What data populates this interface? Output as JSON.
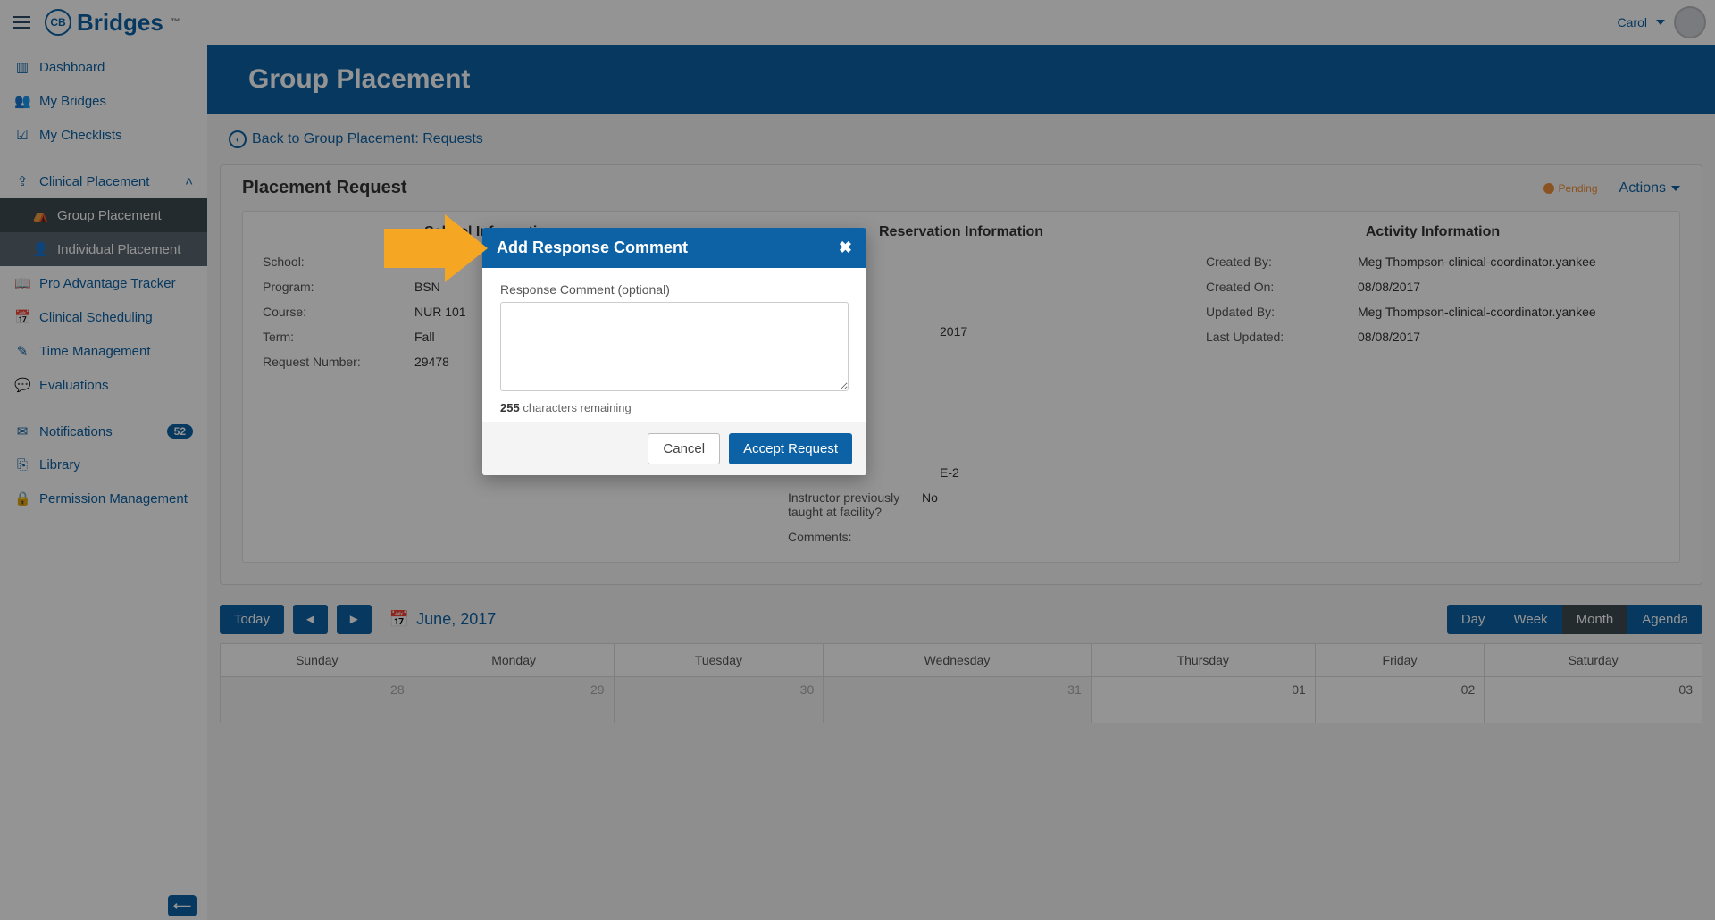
{
  "brand": {
    "badge": "CB",
    "name": "Bridges",
    "tm": "™"
  },
  "user": {
    "name": "Carol"
  },
  "sidebar": {
    "items": [
      {
        "icon": "chart",
        "label": "Dashboard"
      },
      {
        "icon": "group",
        "label": "My Bridges"
      },
      {
        "icon": "check",
        "label": "My Checklists"
      },
      {
        "icon": "upload",
        "label": "Clinical Placement",
        "expanded": true,
        "children": [
          {
            "icon": "bed",
            "label": "Group Placement",
            "active": true
          },
          {
            "icon": "person",
            "label": "Individual Placement"
          }
        ]
      },
      {
        "icon": "book",
        "label": "Pro Advantage Tracker"
      },
      {
        "icon": "calendar",
        "label": "Clinical Scheduling"
      },
      {
        "icon": "edit",
        "label": "Time Management"
      },
      {
        "icon": "chat",
        "label": "Evaluations"
      },
      {
        "gap": true
      },
      {
        "icon": "inbox",
        "label": "Notifications",
        "badge": "52"
      },
      {
        "icon": "copy",
        "label": "Library"
      },
      {
        "icon": "lock",
        "label": "Permission Management"
      }
    ]
  },
  "page": {
    "title": "Group Placement",
    "back": "Back to Group Placement: Requests"
  },
  "panel": {
    "title": "Placement Request",
    "status": "Pending",
    "actions": "Actions",
    "school_head": "School Information",
    "reservation_head": "Reservation Information",
    "activity_head": "Activity Information",
    "school": {
      "School:": "",
      "Program:": "BSN",
      "Course:": "NUR 101",
      "Term:": "Fall",
      "Request Number:": "29478"
    },
    "reservation": {
      "r1_val": "2017",
      "r2_val": "E-2",
      "r3_label": "Instructor previously taught at facility?",
      "r3_val": "No",
      "r4_label": "Comments:"
    },
    "activity": {
      "Created By:": "Meg Thompson-clinical-coordinator.yankee",
      "Created On:": "08/08/2017",
      "Updated By:": "Meg Thompson-clinical-coordinator.yankee",
      "Last Updated:": "08/08/2017"
    }
  },
  "calendar": {
    "today": "Today",
    "title": "June, 2017",
    "views": {
      "day": "Day",
      "week": "Week",
      "month": "Month",
      "agenda": "Agenda"
    },
    "days": [
      "Sunday",
      "Monday",
      "Tuesday",
      "Wednesday",
      "Thursday",
      "Friday",
      "Saturday"
    ],
    "row1": [
      "28",
      "29",
      "30",
      "31",
      "01",
      "02",
      "03"
    ]
  },
  "modal": {
    "title": "Add Response Comment",
    "label": "Response Comment (optional)",
    "chars": "255",
    "chars_suffix": " characters remaining",
    "cancel": "Cancel",
    "accept": "Accept Request"
  },
  "icons": {
    "chart": "▥",
    "group": "👥",
    "check": "☑",
    "upload": "⇪",
    "bed": "⛺",
    "person": "👤",
    "book": "📖",
    "calendar": "📅",
    "edit": "✎",
    "chat": "💬",
    "inbox": "✉",
    "copy": "⎘",
    "lock": "🔒"
  }
}
